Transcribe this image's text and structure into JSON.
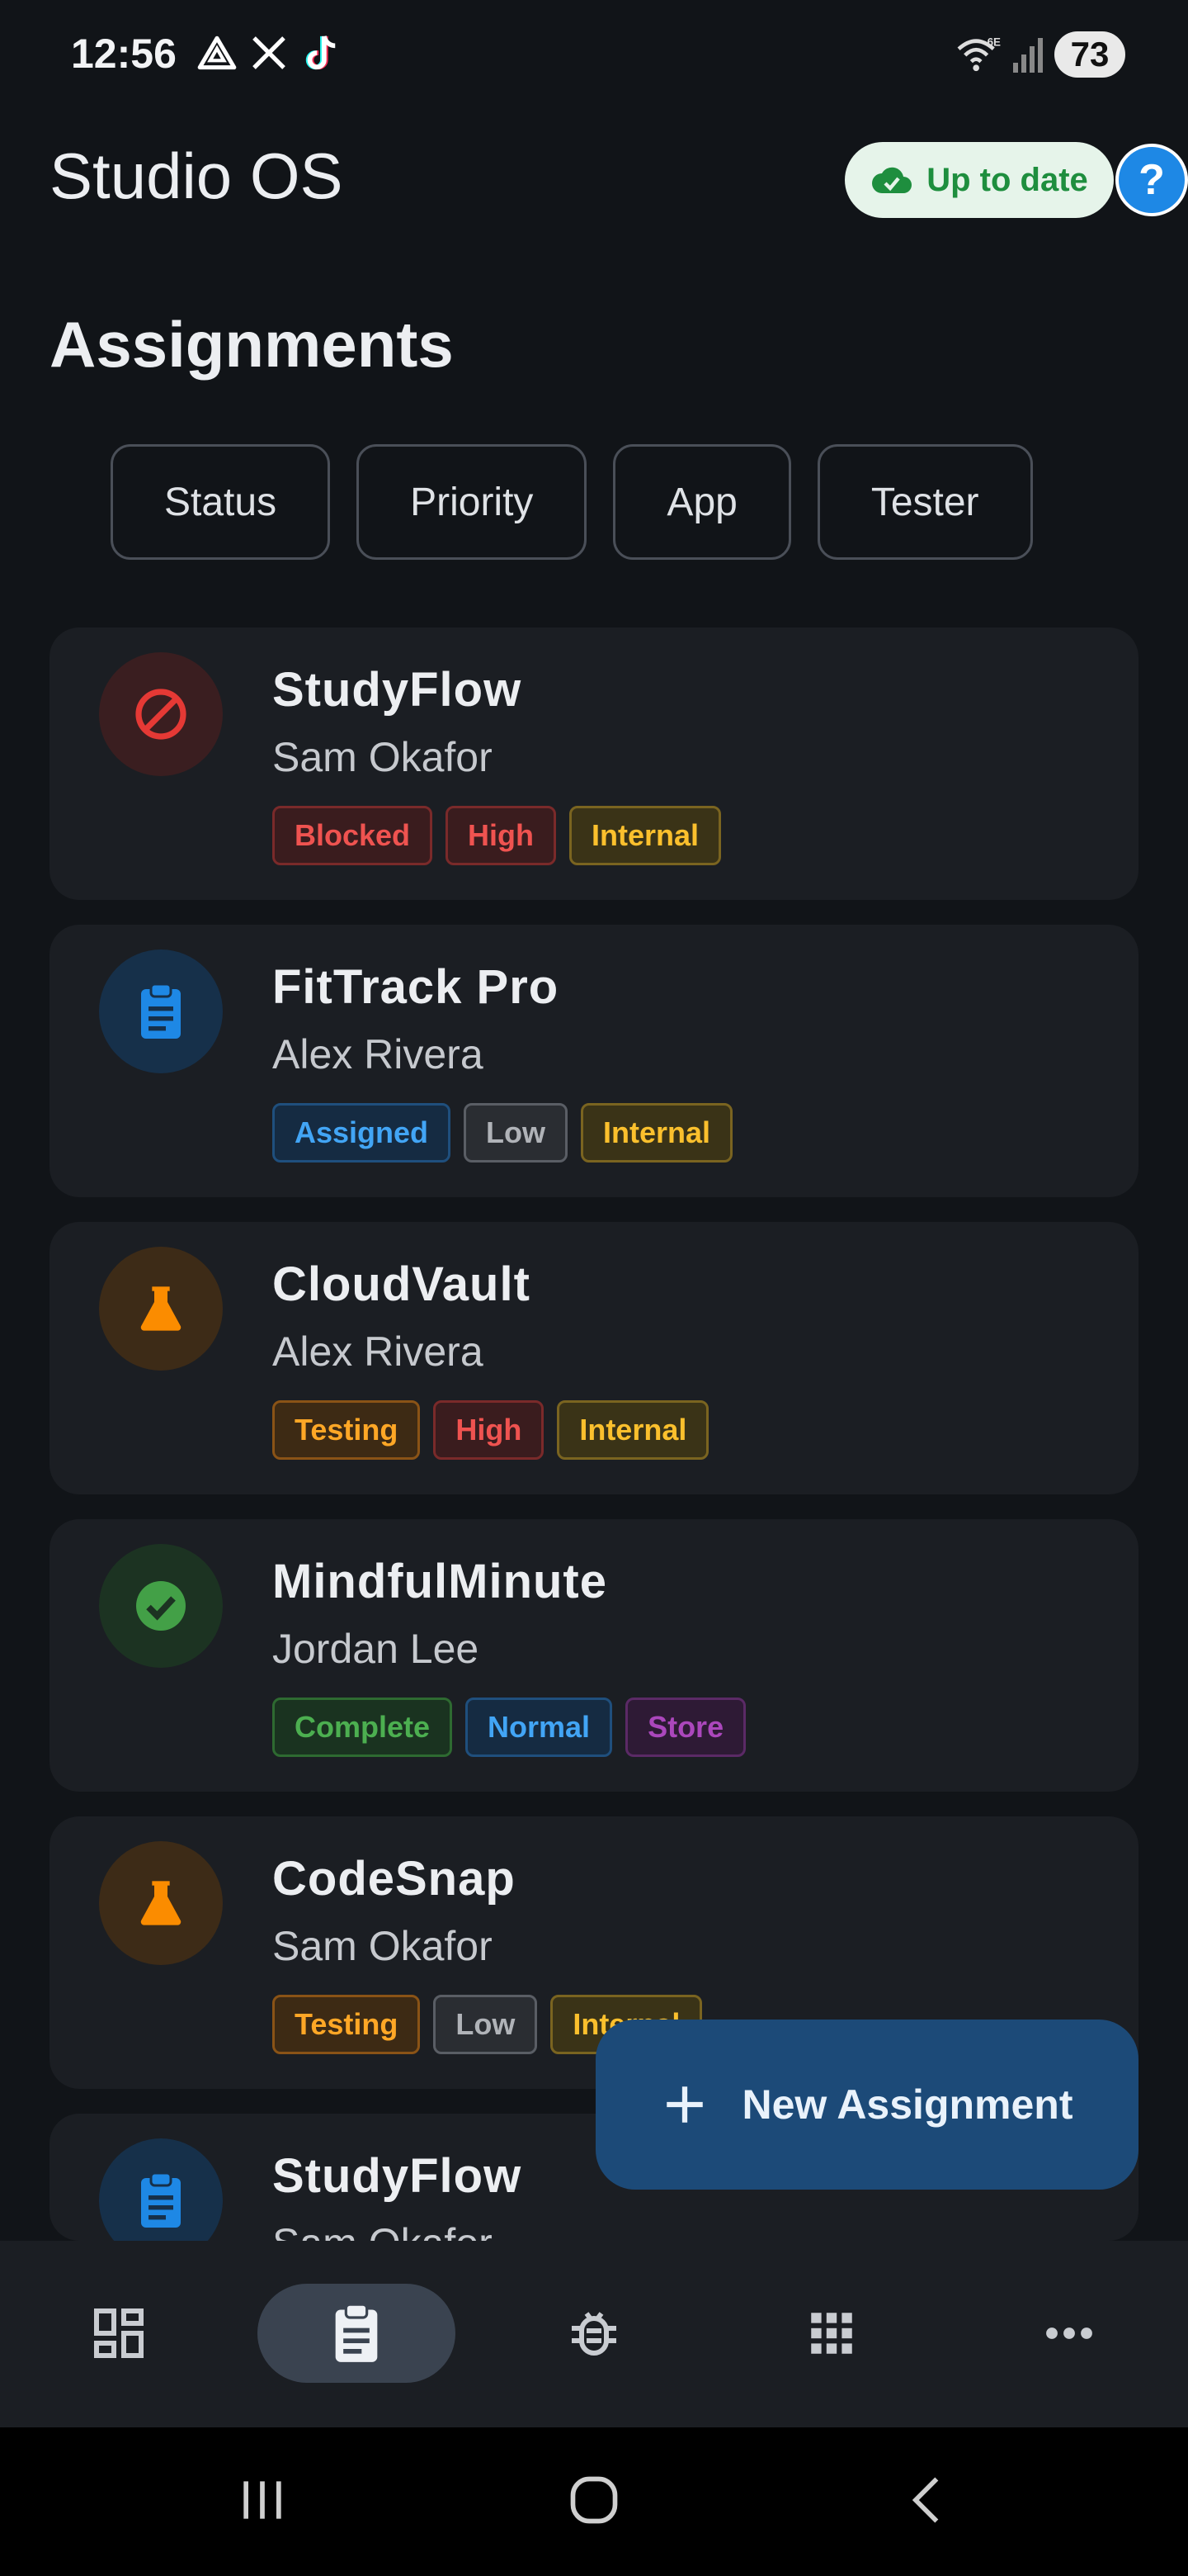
{
  "status_bar": {
    "time": "12:56",
    "notification_icons": [
      "alert-triangle-icon",
      "x-logo-icon",
      "tiktok-icon"
    ],
    "wifi_label": "6E",
    "battery": "73"
  },
  "header": {
    "title": "Studio OS",
    "sync_status": "Up to date",
    "help_label": "?"
  },
  "page": {
    "title": "Assignments"
  },
  "filters": [
    {
      "label": "Status"
    },
    {
      "label": "Priority"
    },
    {
      "label": "App"
    },
    {
      "label": "Tester"
    }
  ],
  "assignments": [
    {
      "app": "StudyFlow",
      "tester": "Sam Okafor",
      "icon": "blocked-icon",
      "tags": [
        {
          "label": "Blocked",
          "color": "red"
        },
        {
          "label": "High",
          "color": "red"
        },
        {
          "label": "Internal",
          "color": "yellow"
        }
      ]
    },
    {
      "app": "FitTrack Pro",
      "tester": "Alex Rivera",
      "icon": "clipboard-icon",
      "tags": [
        {
          "label": "Assigned",
          "color": "blue"
        },
        {
          "label": "Low",
          "color": "gray"
        },
        {
          "label": "Internal",
          "color": "yellow"
        }
      ]
    },
    {
      "app": "CloudVault",
      "tester": "Alex Rivera",
      "icon": "flask-icon",
      "tags": [
        {
          "label": "Testing",
          "color": "orange"
        },
        {
          "label": "High",
          "color": "red"
        },
        {
          "label": "Internal",
          "color": "yellow"
        }
      ]
    },
    {
      "app": "MindfulMinute",
      "tester": "Jordan Lee",
      "icon": "check-circle-icon",
      "tags": [
        {
          "label": "Complete",
          "color": "green"
        },
        {
          "label": "Normal",
          "color": "blue"
        },
        {
          "label": "Store",
          "color": "purple"
        }
      ]
    },
    {
      "app": "CodeSnap",
      "tester": "Sam Okafor",
      "icon": "flask-icon",
      "tags": [
        {
          "label": "Testing",
          "color": "orange"
        },
        {
          "label": "Low",
          "color": "gray"
        },
        {
          "label": "Internal",
          "color": "yellow"
        }
      ]
    },
    {
      "app": "StudyFlow",
      "tester": "Sam Okafor",
      "icon": "clipboard-icon",
      "tags": []
    }
  ],
  "fab": {
    "label": "New Assignment"
  },
  "bottom_nav": [
    {
      "name": "dashboard",
      "icon": "dashboard-icon",
      "active": false
    },
    {
      "name": "assignments",
      "icon": "clipboard-icon",
      "active": true
    },
    {
      "name": "bugs",
      "icon": "bug-icon",
      "active": false
    },
    {
      "name": "apps",
      "icon": "apps-grid-icon",
      "active": false
    },
    {
      "name": "more",
      "icon": "more-horizontal-icon",
      "active": false
    }
  ],
  "colors": {
    "background": "#111418",
    "card": "#1b1e23",
    "accent": "#1e88e5",
    "fab": "#1c4a78",
    "sync_bg": "#e6f4ea",
    "sync_text": "#1e8e3e"
  }
}
